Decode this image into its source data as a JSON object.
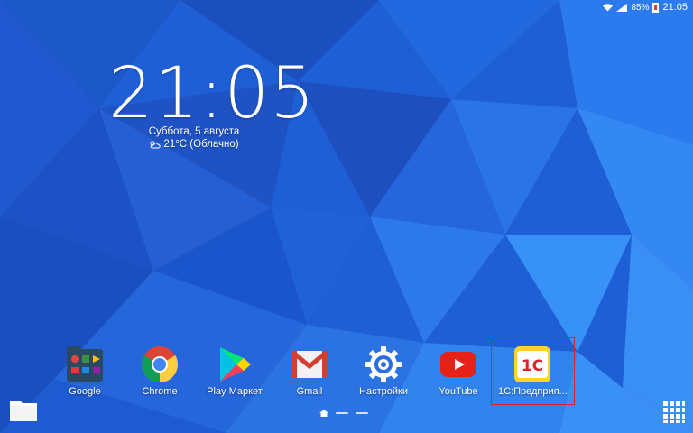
{
  "status_bar": {
    "battery": "85%",
    "time": "21:05",
    "icons": [
      "wifi-icon",
      "signal-icon",
      "battery-icon"
    ]
  },
  "clock_widget": {
    "time": "21:05",
    "date": "Суббота, 5 августа",
    "weather": "21°C (Облачно)",
    "weather_icon": "cloud-sun-icon"
  },
  "dock": {
    "apps": [
      {
        "label": "Google",
        "icon": "google-folder-icon"
      },
      {
        "label": "Chrome",
        "icon": "chrome-icon"
      },
      {
        "label": "Play Маркет",
        "icon": "play-store-icon"
      },
      {
        "label": "Gmail",
        "icon": "gmail-icon"
      },
      {
        "label": "Настройки",
        "icon": "settings-gear-icon"
      },
      {
        "label": "YouTube",
        "icon": "youtube-icon"
      },
      {
        "label": "1С:Предприя...",
        "icon": "1c-enterprise-icon"
      }
    ],
    "selected_index": 6
  },
  "page_indicator": {
    "pages": 3,
    "current": 0
  },
  "colors": {
    "wallpaper_base": "#1f5fd6",
    "selection_border": "#d9242a",
    "youtube_red": "#e62117",
    "onec_yellow": "#ffd42a"
  }
}
